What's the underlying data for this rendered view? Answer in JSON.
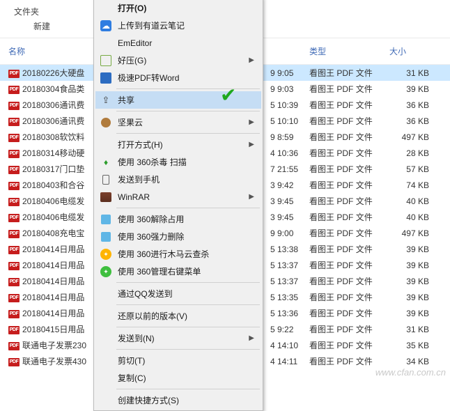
{
  "toolbar": {
    "label1": "文件夹",
    "label2": "新建"
  },
  "columns": {
    "name": "名称",
    "type": "类型",
    "size": "大小"
  },
  "rows": [
    {
      "name": "20180226大硬盘",
      "timefrag": "9 9:05",
      "type": "看图王 PDF 文件",
      "size": "31 KB",
      "sel": true
    },
    {
      "name": "20180304食品类",
      "timefrag": "9 9:03",
      "type": "看图王 PDF 文件",
      "size": "39 KB"
    },
    {
      "name": "20180306通讯费",
      "timefrag": "5 10:39",
      "type": "看图王 PDF 文件",
      "size": "36 KB"
    },
    {
      "name": "20180306通讯费",
      "timefrag": "5 10:10",
      "type": "看图王 PDF 文件",
      "size": "36 KB"
    },
    {
      "name": "20180308软饮料",
      "timefrag": "9 8:59",
      "type": "看图王 PDF 文件",
      "size": "497 KB"
    },
    {
      "name": "20180314移动硬",
      "timefrag": "4 10:36",
      "type": "看图王 PDF 文件",
      "size": "28 KB"
    },
    {
      "name": "20180317门口垫",
      "timefrag": "7 21:55",
      "type": "看图王 PDF 文件",
      "size": "57 KB"
    },
    {
      "name": "20180403和合谷",
      "timefrag": "3 9:42",
      "type": "看图王 PDF 文件",
      "size": "74 KB"
    },
    {
      "name": "20180406电缆发",
      "timefrag": "3 9:45",
      "type": "看图王 PDF 文件",
      "size": "40 KB"
    },
    {
      "name": "20180406电缆发",
      "timefrag": "3 9:45",
      "type": "看图王 PDF 文件",
      "size": "40 KB"
    },
    {
      "name": "20180408充电宝",
      "timefrag": "9 9:00",
      "type": "看图王 PDF 文件",
      "size": "497 KB"
    },
    {
      "name": "20180414日用品",
      "timefrag": "5 13:38",
      "type": "看图王 PDF 文件",
      "size": "39 KB"
    },
    {
      "name": "20180414日用品",
      "timefrag": "5 13:37",
      "type": "看图王 PDF 文件",
      "size": "39 KB"
    },
    {
      "name": "20180414日用品",
      "timefrag": "5 13:37",
      "type": "看图王 PDF 文件",
      "size": "39 KB"
    },
    {
      "name": "20180414日用品",
      "timefrag": "5 13:35",
      "type": "看图王 PDF 文件",
      "size": "39 KB"
    },
    {
      "name": "20180414日用品",
      "timefrag": "5 13:36",
      "type": "看图王 PDF 文件",
      "size": "39 KB"
    },
    {
      "name": "20180415日用品",
      "timefrag": "5 9:22",
      "type": "看图王 PDF 文件",
      "size": "31 KB"
    },
    {
      "name": "联通电子发票230",
      "timefrag": "4 14:10",
      "type": "看图王 PDF 文件",
      "size": "35 KB"
    },
    {
      "name": "联通电子发票430",
      "timefrag": "4 14:11",
      "type": "看图王 PDF 文件",
      "size": "34 KB"
    }
  ],
  "menu": [
    {
      "label": "打开(O)",
      "bold": true
    },
    {
      "label": "上传到有道云笔记",
      "icon": "cloud"
    },
    {
      "label": "EmEditor"
    },
    {
      "label": "好压(G)",
      "icon": "hz",
      "arrow": true
    },
    {
      "label": "极速PDF转Word",
      "icon": "wd"
    },
    {
      "sep": true
    },
    {
      "label": "共享",
      "icon": "share",
      "hl": true
    },
    {
      "sep": true
    },
    {
      "label": "坚果云",
      "icon": "nut",
      "arrow": true
    },
    {
      "sep": true
    },
    {
      "label": "打开方式(H)",
      "arrow": true
    },
    {
      "label": "使用 360杀毒 扫描",
      "icon": "shield"
    },
    {
      "label": "发送到手机",
      "icon": "phone"
    },
    {
      "label": "WinRAR",
      "icon": "rar",
      "arrow": true
    },
    {
      "sep": true
    },
    {
      "label": "使用 360解除占用",
      "icon": "sq1"
    },
    {
      "label": "使用 360强力删除",
      "icon": "sq2"
    },
    {
      "label": "使用 360进行木马云查杀",
      "icon": "c360g"
    },
    {
      "label": "使用 360管理右键菜单",
      "icon": "c360y"
    },
    {
      "sep": true
    },
    {
      "label": "通过QQ发送到"
    },
    {
      "sep": true
    },
    {
      "label": "还原以前的版本(V)"
    },
    {
      "sep": true
    },
    {
      "label": "发送到(N)",
      "arrow": true
    },
    {
      "sep": true
    },
    {
      "label": "剪切(T)"
    },
    {
      "label": "复制(C)"
    },
    {
      "sep": true
    },
    {
      "label": "创建快捷方式(S)"
    }
  ],
  "watermark": "www.cfan.com.cn"
}
